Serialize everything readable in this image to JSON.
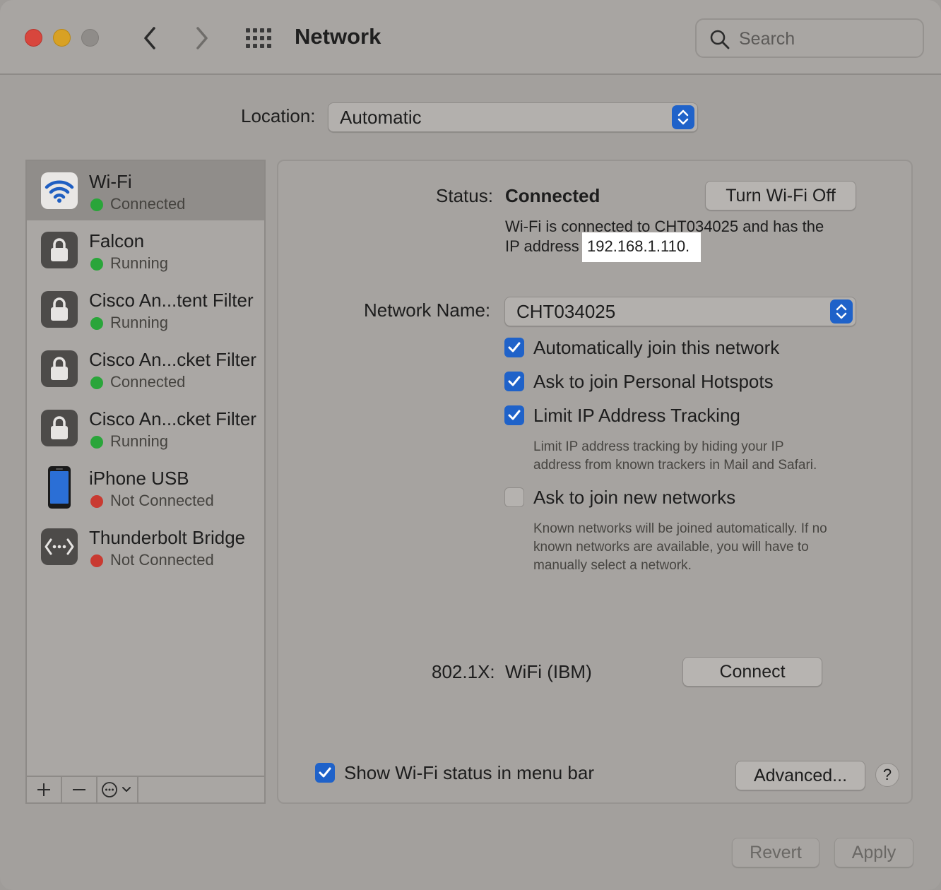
{
  "window": {
    "title": "Network",
    "search_placeholder": "Search"
  },
  "location": {
    "label": "Location:",
    "value": "Automatic"
  },
  "services": [
    {
      "name": "Wi-Fi",
      "status": "Connected",
      "status_color": "#2aa53a",
      "icon": "wifi-icon",
      "selected": true
    },
    {
      "name": "Falcon",
      "status": "Running",
      "status_color": "#2aa53a",
      "icon": "lock-icon"
    },
    {
      "name": "Cisco An...tent Filter",
      "status": "Running",
      "status_color": "#2aa53a",
      "icon": "lock-icon"
    },
    {
      "name": "Cisco An...cket Filter",
      "status": "Connected",
      "status_color": "#2aa53a",
      "icon": "lock-icon"
    },
    {
      "name": "Cisco An...cket Filter",
      "status": "Running",
      "status_color": "#2aa53a",
      "icon": "lock-icon"
    },
    {
      "name": "iPhone USB",
      "status": "Not Connected",
      "status_color": "#c93a31",
      "icon": "iphone-icon"
    },
    {
      "name": "Thunderbolt Bridge",
      "status": "Not Connected",
      "status_color": "#c93a31",
      "icon": "thunderbolt-bridge-icon"
    }
  ],
  "sidebar_tools": {
    "add_icon": "plus-icon",
    "remove_icon": "minus-icon",
    "action_icon": "ellipsis-menu-icon"
  },
  "detail": {
    "status_label": "Status:",
    "status_value": "Connected",
    "turn_off_button": "Turn Wi-Fi Off",
    "status_desc_line1": "Wi-Fi is connected to CHT034025 and has the",
    "status_desc_line2_prefix": "IP address",
    "ip_address": "192.168.1.110.",
    "network_name_label": "Network Name:",
    "network_name_value": "CHT034025",
    "options": [
      {
        "label": "Automatically join this network",
        "checked": true
      },
      {
        "label": "Ask to join Personal Hotspots",
        "checked": true
      },
      {
        "label": "Limit IP Address Tracking",
        "checked": true
      },
      {
        "label": "Ask to join new networks",
        "checked": false
      }
    ],
    "limit_ip_help_line1": "Limit IP address tracking by hiding your IP",
    "limit_ip_help_line2": "address from known trackers in Mail and Safari.",
    "ask_new_help_line1": "Known networks will be joined automatically. If no",
    "ask_new_help_line2": "known networks are available, you will have to",
    "ask_new_help_line3": "manually select a network.",
    "dot1x_label": "802.1X:",
    "dot1x_value": "WiFi (IBM)",
    "connect_button": "Connect",
    "show_status_label": "Show Wi-Fi status in menu bar",
    "show_status_checked": true,
    "advanced_button": "Advanced...",
    "help_button": "?"
  },
  "footer": {
    "revert_button": "Revert",
    "apply_button": "Apply"
  }
}
